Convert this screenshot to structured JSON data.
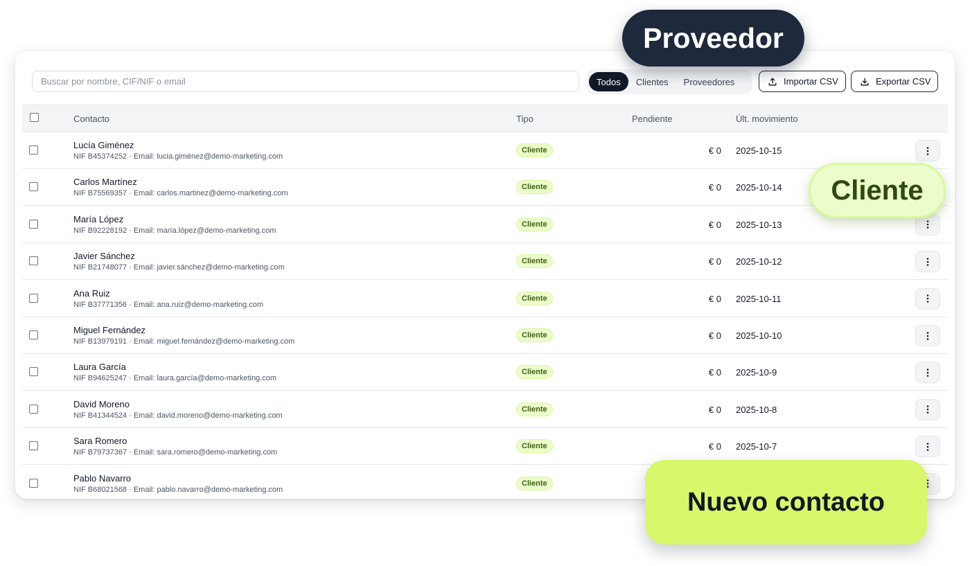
{
  "toolbar": {
    "search_placeholder": "Buscar por nombre, CIF/NIF o email",
    "filters": [
      "Todos",
      "Clientes",
      "Proveedores"
    ],
    "active_filter": "Todos",
    "import_label": "Importar CSV",
    "export_label": "Exportar CSV"
  },
  "table": {
    "columns": {
      "contact": "Contacto",
      "type": "Tipo",
      "pending": "Pendiente",
      "last_movement": "Últ. movimiento"
    },
    "rows": [
      {
        "name": "Lucía Giménez",
        "meta": "NIF B45374252 · Email: lucia.giménez@demo-marketing.com",
        "type": "Cliente",
        "pending": "€ 0",
        "date": "2025-10-15"
      },
      {
        "name": "Carlos Martínez",
        "meta": "NIF B75569357 · Email: carlos.martinez@demo-marketing.com",
        "type": "Cliente",
        "pending": "€ 0",
        "date": "2025-10-14"
      },
      {
        "name": "María López",
        "meta": "NIF B92228192 · Email: maría.lópez@demo-marketing.com",
        "type": "Cliente",
        "pending": "€ 0",
        "date": "2025-10-13"
      },
      {
        "name": "Javier Sánchez",
        "meta": "NIF B21748077 · Email: javier.sánchez@demo-marketing.com",
        "type": "Cliente",
        "pending": "€ 0",
        "date": "2025-10-12"
      },
      {
        "name": "Ana Ruiz",
        "meta": "NIF B37771356 · Email: ana.ruiz@demo-marketing.com",
        "type": "Cliente",
        "pending": "€ 0",
        "date": "2025-10-11"
      },
      {
        "name": "Miguel Fernández",
        "meta": "NIF B13979191 · Email: miguel.fernández@demo-marketing.com",
        "type": "Cliente",
        "pending": "€ 0",
        "date": "2025-10-10"
      },
      {
        "name": "Laura García",
        "meta": "NIF B94625247 · Email: laura.garcía@demo-marketing.com",
        "type": "Cliente",
        "pending": "€ 0",
        "date": "2025-10-9"
      },
      {
        "name": "David Moreno",
        "meta": "NIF B41344524 · Email: david.moreno@demo-marketing.com",
        "type": "Cliente",
        "pending": "€ 0",
        "date": "2025-10-8"
      },
      {
        "name": "Sara Romero",
        "meta": "NIF B79737367 · Email: sara.romero@demo-marketing.com",
        "type": "Cliente",
        "pending": "€ 0",
        "date": "2025-10-7"
      },
      {
        "name": "Pablo Navarro",
        "meta": "NIF B68021568 · Email: pablo.navarro@demo-marketing.com",
        "type": "Cliente",
        "pending": "",
        "date": ""
      }
    ]
  },
  "callouts": {
    "provider": "Proveedor",
    "client": "Cliente",
    "new_contact": "Nuevo contacto"
  },
  "colors": {
    "dark": "#1e293b",
    "badge_bg": "#ecfccb",
    "badge_text": "#3f6212",
    "accent_lime": "#d9f76a"
  }
}
